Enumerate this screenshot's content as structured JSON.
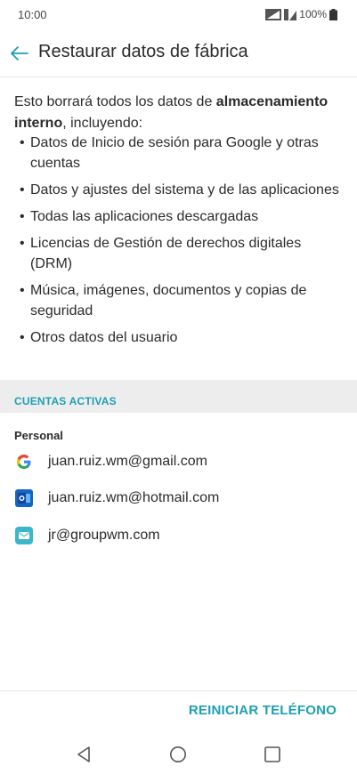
{
  "status": {
    "time": "10:00",
    "battery": "100%"
  },
  "header": {
    "title": "Restaurar datos de fábrica"
  },
  "intro": {
    "text_before": "Esto borrará todos los datos de ",
    "bold": "almacenamiento interno",
    "text_after": ", incluyendo:"
  },
  "bullets": [
    "Datos de Inicio de sesión para Google y otras cuentas",
    "Datos y ajustes del sistema y de las aplicaciones",
    "Todas las aplicaciones descargadas",
    "Licencias de Gestión de derechos digitales (DRM)",
    "Música, imágenes, documentos y copias de seguridad",
    "Otros datos del usuario"
  ],
  "accounts_section": {
    "title": "CUENTAS ACTIVAS",
    "group": "Personal",
    "items": [
      {
        "email": "juan.ruiz.wm@gmail.com",
        "icon": "google-icon"
      },
      {
        "email": "juan.ruiz.wm@hotmail.com",
        "icon": "outlook-icon"
      },
      {
        "email": "jr@groupwm.com",
        "icon": "email-icon"
      }
    ]
  },
  "action": {
    "reset_label": "REINICIAR TELÉFONO"
  },
  "colors": {
    "accent": "#1e9fb4",
    "section_bg": "#ededed"
  }
}
